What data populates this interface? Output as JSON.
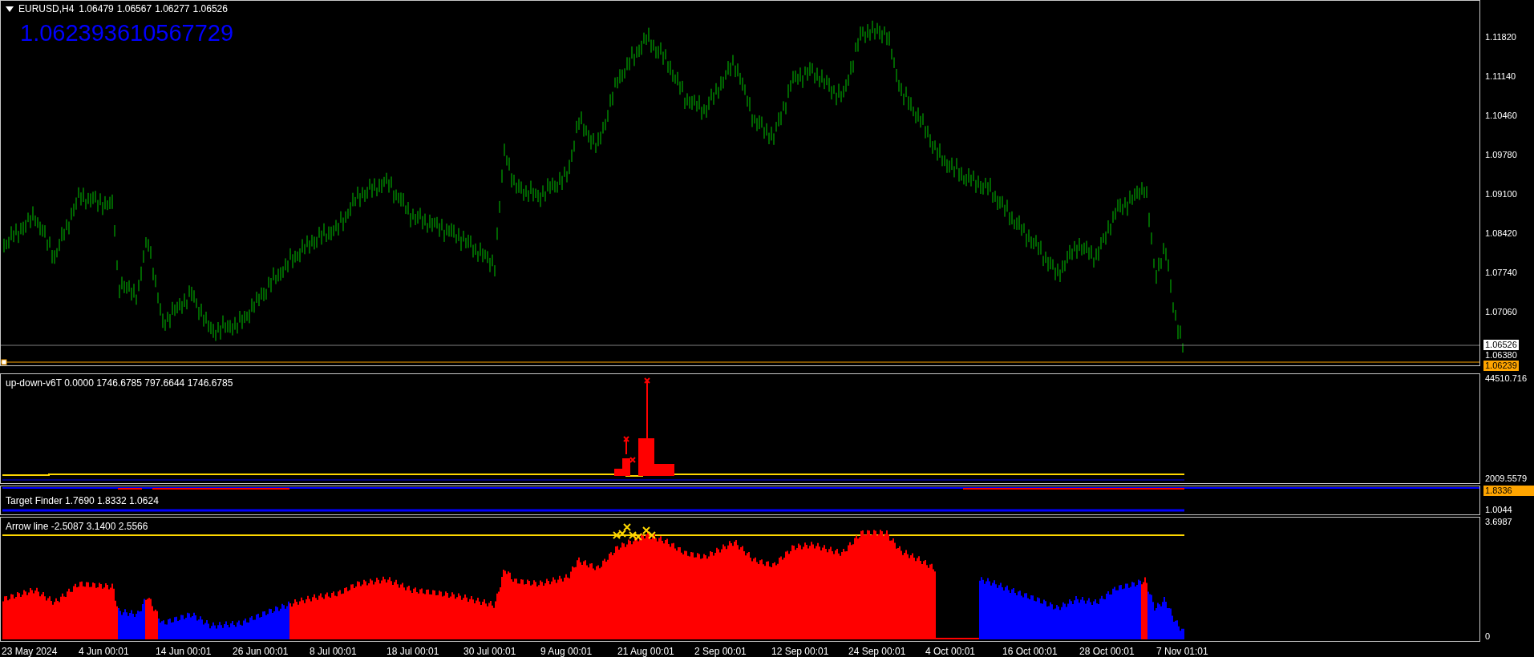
{
  "header": {
    "symbol": "EURUSD,H4",
    "ohlc": [
      "1.06479",
      "1.06567",
      "1.06277",
      "1.06526"
    ]
  },
  "price_label": "1.062393610567729",
  "main_axis": [
    {
      "text": "1.11820",
      "kind": "tick"
    },
    {
      "text": "1.11140",
      "kind": "tick"
    },
    {
      "text": "1.10460",
      "kind": "tick"
    },
    {
      "text": "1.09780",
      "kind": "tick"
    },
    {
      "text": "1.09100",
      "kind": "tick"
    },
    {
      "text": "1.08420",
      "kind": "tick"
    },
    {
      "text": "1.07740",
      "kind": "tick"
    },
    {
      "text": "1.07060",
      "kind": "tick"
    },
    {
      "text": "1.06526",
      "kind": "current"
    },
    {
      "text": "1.06380",
      "kind": "tick"
    },
    {
      "text": "1.06239",
      "kind": "level"
    }
  ],
  "indicators": [
    {
      "kind": "updown",
      "label": "up-down-v6T 0.0000 1746.6785 797.6644 1746.6785",
      "axis": [
        {
          "text": "44510.716",
          "kind": "tick"
        },
        {
          "text": "2009.5579",
          "kind": "tick"
        }
      ]
    },
    {
      "kind": "target",
      "label": "Target Finder 1.7690 1.8332 1.0624",
      "axis": [
        {
          "text": "1.8336",
          "kind": "level"
        },
        {
          "text": "1.0044",
          "kind": "tick"
        }
      ]
    },
    {
      "kind": "arrow",
      "label": "Arrow line -2.5087 3.1400 2.5566",
      "axis": [
        {
          "text": "3.6987",
          "kind": "tick"
        },
        {
          "text": "0",
          "kind": "tick"
        }
      ]
    }
  ],
  "time_axis": [
    "23 May 2024",
    "4 Jun 00:01",
    "14 Jun 00:01",
    "26 Jun 00:01",
    "8 Jul 00:01",
    "18 Jul 00:01",
    "30 Jul 00:01",
    "9 Aug 00:01",
    "21 Aug 00:01",
    "2 Sep 00:01",
    "12 Sep 00:01",
    "24 Sep 00:01",
    "4 Oct 00:01",
    "16 Oct 00:01",
    "28 Oct 00:01",
    "7 Nov 01:01"
  ]
}
